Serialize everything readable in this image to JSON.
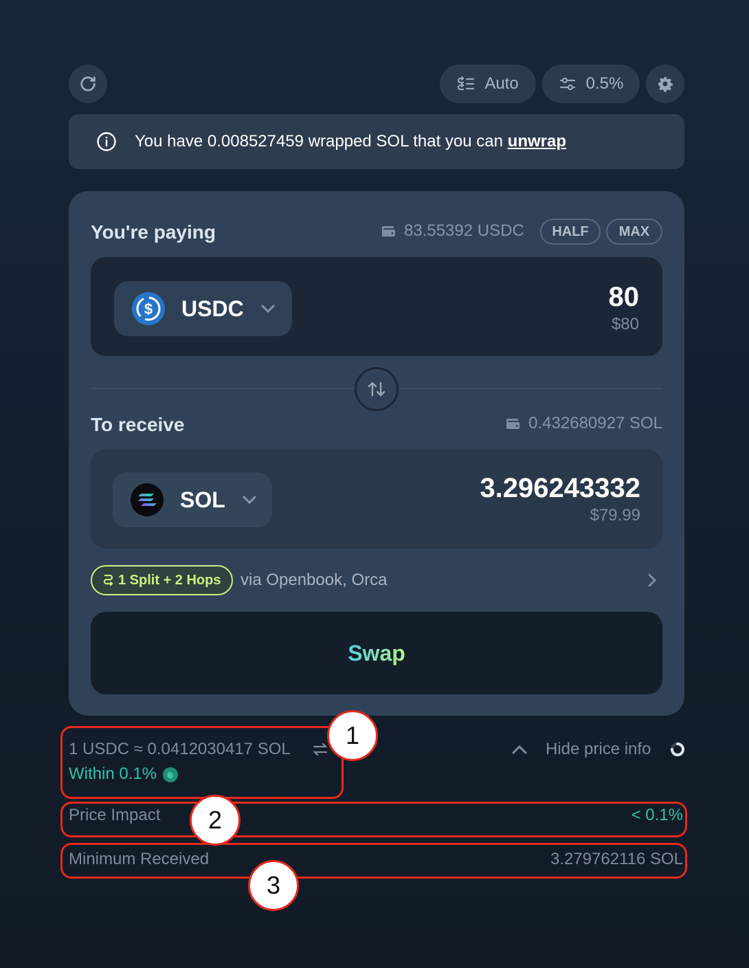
{
  "toolbar": {
    "refresh_icon": "refresh-icon",
    "routing_label": "Auto",
    "slippage_label": "0.5%",
    "settings_icon": "gear-icon"
  },
  "notice": {
    "text": "You have 0.008527459 wrapped SOL that you can",
    "link": "unwrap"
  },
  "paying": {
    "label": "You're paying",
    "balance": "83.55392 USDC",
    "half_label": "HALF",
    "max_label": "MAX",
    "token": "USDC",
    "amount": "80",
    "amount_usd": "$80"
  },
  "receiving": {
    "label": "To receive",
    "balance": "0.432680927 SOL",
    "token": "SOL",
    "amount": "3.296243332",
    "amount_usd": "$79.99"
  },
  "route": {
    "badge": "1 Split + 2 Hops",
    "via": "via Openbook, Orca"
  },
  "swap_button": "Swap",
  "price_info": {
    "rate": "1 USDC ≈ 0.0412030417 SOL",
    "within": "Within 0.1%",
    "hide_label": "Hide price info",
    "price_impact_label": "Price Impact",
    "price_impact_value": "< 0.1%",
    "minimum_received_label": "Minimum Received",
    "minimum_received_value": "3.279762116 SOL"
  },
  "annotations": [
    "1",
    "2",
    "3"
  ],
  "colors": {
    "accent_teal": "#34c2a4",
    "route_green": "#c7f284",
    "annotation_red": "#e5291d",
    "card_bg": "#304257"
  }
}
